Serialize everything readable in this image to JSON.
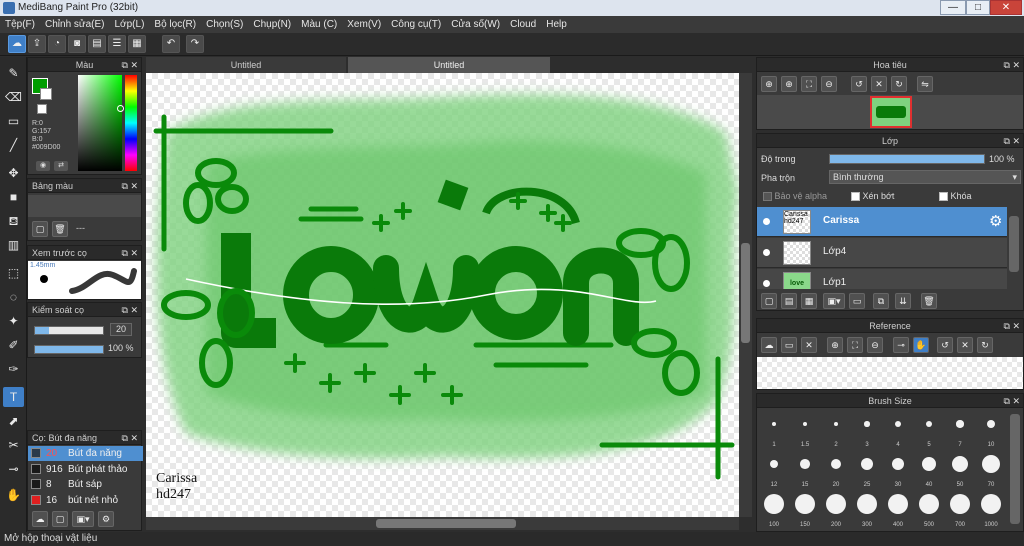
{
  "window": {
    "title": "MediBang Paint Pro (32bit)",
    "buttons": [
      "—",
      "□",
      "✕"
    ]
  },
  "menu": [
    "Tệp(F)",
    "Chỉnh sửa(E)",
    "Lớp(L)",
    "Bộ lọc(R)",
    "Chọn(S)",
    "Chụp(N)",
    "Màu (C)",
    "Xem(V)",
    "Công cụ(T)",
    "Cửa số(W)",
    "Cloud",
    "Help"
  ],
  "tabs": [
    "Untitled",
    "Untitled"
  ],
  "color_panel": {
    "title": "Màu",
    "r": "R:0",
    "g": "G:157",
    "b": "B:0",
    "hex": "#009D00",
    "fg_color": "#009d00"
  },
  "palette_panel": {
    "title": "Bảng màu",
    "empty": "---"
  },
  "brush_preview_panel": {
    "title": "Xem trước cọ",
    "size": "1.45mm"
  },
  "control_panel": {
    "title": "Kiểm soát cọ",
    "size_value": "20",
    "opacity_value": "100 %",
    "size_fraction": 0.2,
    "opacity_fraction": 1.0
  },
  "brush_list_panel": {
    "title": "Cọ: Bút đa năng",
    "items": [
      {
        "num": "20",
        "name": "Bút đa năng",
        "color": "#2a3a4a"
      },
      {
        "num": "916",
        "name": "Bút phát thảo",
        "color": "#1a1a1a"
      },
      {
        "num": "8",
        "name": "Bút sáp",
        "color": "#1a1a1a"
      },
      {
        "num": "16",
        "name": "bút nét nhỏ",
        "color": "#e02020"
      }
    ]
  },
  "canvas": {
    "signature_line1": "Carissa",
    "signature_line2": "hd247",
    "accent": "#0a8a0a",
    "wash": "#7ed67e"
  },
  "navigator_panel": {
    "title": "Hoa tiêu"
  },
  "layer_panel": {
    "title": "Lớp",
    "opacity_label": "Độ trong",
    "opacity_value": "100 %",
    "opacity_fraction": 1.0,
    "blend_label": "Pha trộn",
    "blend_value": "Bình thường",
    "protect_alpha": "Bảo vệ alpha",
    "clipping": "Xén bớt",
    "lock": "Khóa",
    "layers": [
      {
        "name": "Carissa",
        "thumb_text": "Carissa hd247",
        "selected": true
      },
      {
        "name": "Lớp4",
        "thumb_text": "",
        "selected": false
      },
      {
        "name": "Lớp1",
        "thumb_text": "love",
        "selected": false
      }
    ]
  },
  "reference_panel": {
    "title": "Reference"
  },
  "brushsize_panel": {
    "title": "Brush Size",
    "sizes": [
      "1",
      "1.5",
      "2",
      "3",
      "4",
      "5",
      "7",
      "10",
      "12",
      "15",
      "20",
      "25",
      "30",
      "40",
      "50",
      "70",
      "100",
      "150",
      "200",
      "300",
      "400",
      "500",
      "700",
      "1000"
    ]
  },
  "status": {
    "text": "Mở hộp thoại vật liệu"
  }
}
